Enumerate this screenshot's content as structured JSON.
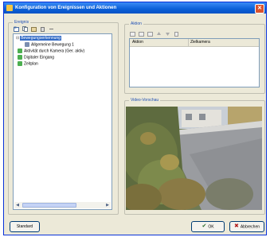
{
  "window": {
    "title": "Konfiguration von Ereignissen und Aktionen",
    "close_glyph": "✕"
  },
  "left_group": {
    "label": "Ereignis",
    "toolbar_icons": [
      "add-icon",
      "copy-icon",
      "paste-icon",
      "delete-icon",
      "properties-icon"
    ],
    "tree": [
      {
        "label": "Bewegungserkennung",
        "selected": true,
        "icon": "event-icon",
        "level": 0
      },
      {
        "label": "Allgemeine Bewegung 1",
        "selected": false,
        "icon": "motion-icon",
        "level": 1
      },
      {
        "label": "Aktivität durch Kamera (Ger. aktiv)",
        "selected": false,
        "icon": "camera-event-icon",
        "level": 0
      },
      {
        "label": "Digitaler Eingang",
        "selected": false,
        "icon": "input-icon",
        "level": 0
      },
      {
        "label": "Zeitplan",
        "selected": false,
        "icon": "schedule-icon",
        "level": 0
      }
    ],
    "scroll_left": "◀",
    "scroll_right": "▶"
  },
  "right_group": {
    "label": "Aktion",
    "toolbar_icons": [
      "add-icon",
      "edit-icon",
      "delete-icon",
      "up-icon",
      "down-icon",
      "copy-icon"
    ],
    "columns": [
      "Aktion",
      "Zielkamera"
    ]
  },
  "preview_group": {
    "label": "Video-Vorschau"
  },
  "buttons": {
    "default": "Standard",
    "ok": "OK",
    "cancel": "Abbrechen",
    "ok_glyph": "✔",
    "cancel_glyph": "✖"
  },
  "colors": {
    "title_bar": "#0a5fd8",
    "selection": "#316ac5",
    "group_label": "#1f4fb4"
  }
}
